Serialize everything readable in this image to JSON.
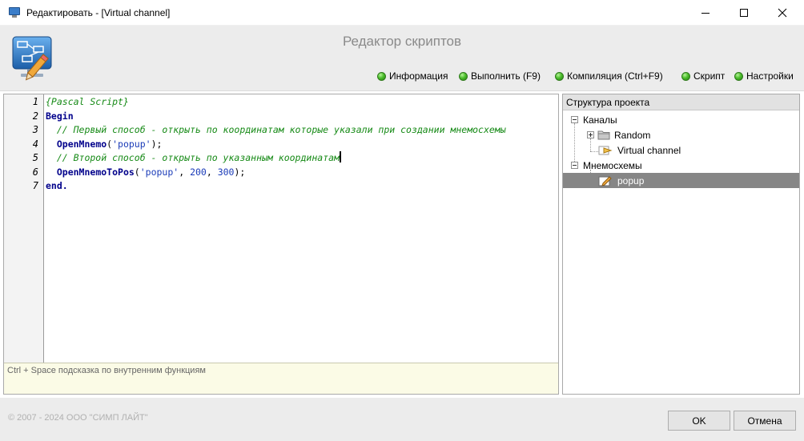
{
  "window": {
    "title": "Редактировать - [Virtual channel]",
    "icon": "monitor-app-icon",
    "controls": [
      "minimize",
      "maximize",
      "close"
    ]
  },
  "header": {
    "caption": "Редактор скриптов",
    "logo": "script-editor-logo"
  },
  "menu": {
    "info": "Информация",
    "run": "Выполнить (F9)",
    "compile": "Компиляция (Ctrl+F9)",
    "script": "Скрипт",
    "settings": "Настройки"
  },
  "editor": {
    "line_numbers": [
      "1",
      "2",
      "3",
      "4",
      "5",
      "6",
      "7"
    ],
    "lines": [
      [
        {
          "t": "{Pascal Script}",
          "c": "comment"
        }
      ],
      [
        {
          "t": "Begin",
          "c": "kw"
        }
      ],
      [
        {
          "t": "  // Первый способ - открыть по координатам которые указали при создании мнемосхемы",
          "c": "comment"
        }
      ],
      [
        {
          "t": "  ",
          "c": "plain"
        },
        {
          "t": "OpenMnemo",
          "c": "kw"
        },
        {
          "t": "(",
          "c": "plain"
        },
        {
          "t": "'popup'",
          "c": "str"
        },
        {
          "t": ");",
          "c": "plain"
        }
      ],
      [
        {
          "t": "  // Второй способ - открыть по указанным координатам",
          "c": "comment"
        }
      ],
      [
        {
          "t": "  ",
          "c": "plain"
        },
        {
          "t": "OpenMnemoToPos",
          "c": "kw"
        },
        {
          "t": "(",
          "c": "plain"
        },
        {
          "t": "'popup'",
          "c": "str"
        },
        {
          "t": ", ",
          "c": "plain"
        },
        {
          "t": "200",
          "c": "num"
        },
        {
          "t": ", ",
          "c": "plain"
        },
        {
          "t": "300",
          "c": "num"
        },
        {
          "t": ");",
          "c": "plain"
        }
      ],
      [
        {
          "t": "end.",
          "c": "kw"
        }
      ]
    ],
    "caret_line": 5,
    "hint": "Ctrl + Space подсказка по внутренним функциям"
  },
  "tree": {
    "header": "Структура проекта",
    "channels": "Каналы",
    "random": "Random",
    "virtual_channel": "Virtual channel",
    "mnemos": "Мнемосхемы",
    "popup": "popup"
  },
  "footer": {
    "copyright": "© 2007 - 2024  ООО \"СИМП ЛАЙТ\"",
    "ok": "OK",
    "cancel": "Отмена"
  }
}
